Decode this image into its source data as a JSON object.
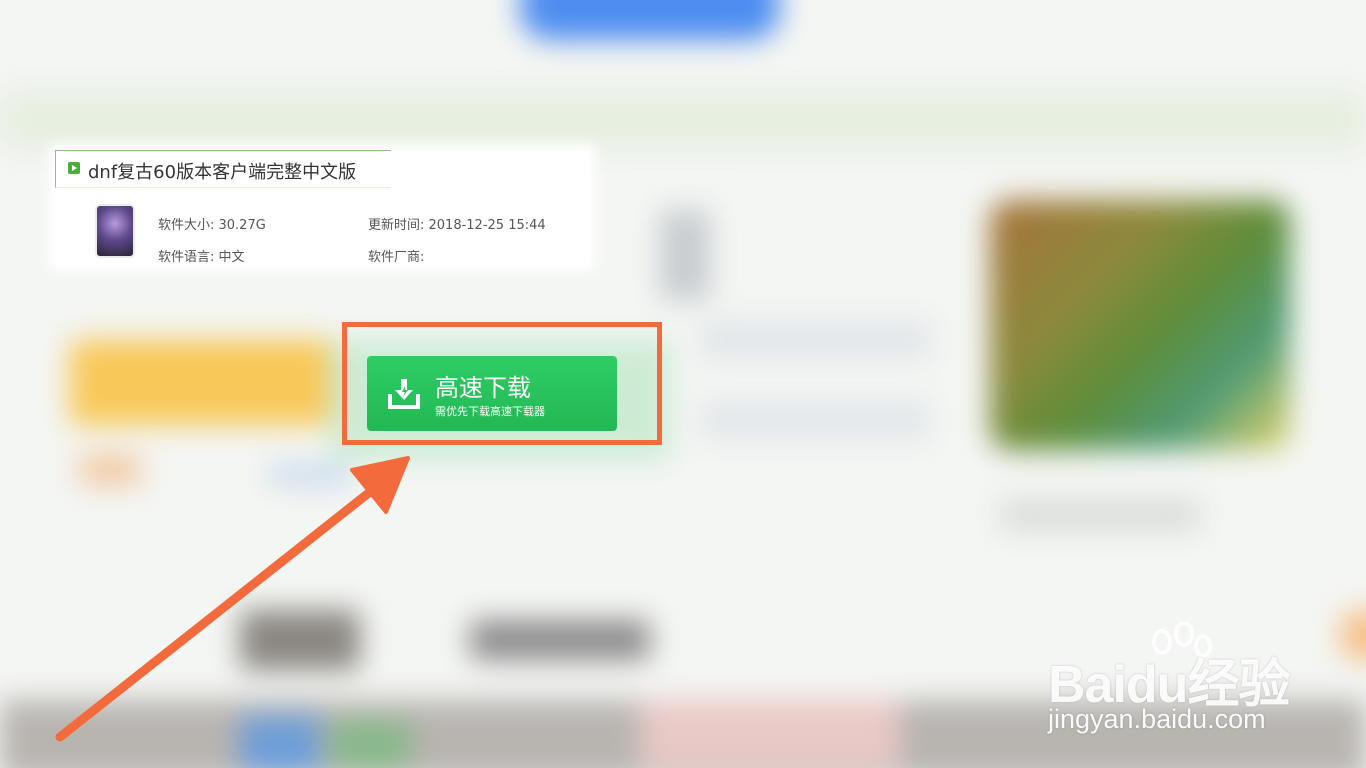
{
  "app": {
    "title": "dnf复古60版本客户端完整中文版",
    "size": "软件大小: 30.27G",
    "updated": "更新时间: 2018-12-25 15:44",
    "language": "软件语言: 中文",
    "vendor": "软件厂商:",
    "title_icon": "play-icon"
  },
  "download": {
    "label": "高速下载",
    "sublabel": "需优先下载高速下载器",
    "icon": "download-icon",
    "color": "#27c05c"
  },
  "annotation": {
    "highlight_color": "#f36b3c",
    "arrow_color": "#f36b3c"
  },
  "watermark": {
    "logo": "Baidu经验",
    "url": "jingyan.baidu.com"
  }
}
